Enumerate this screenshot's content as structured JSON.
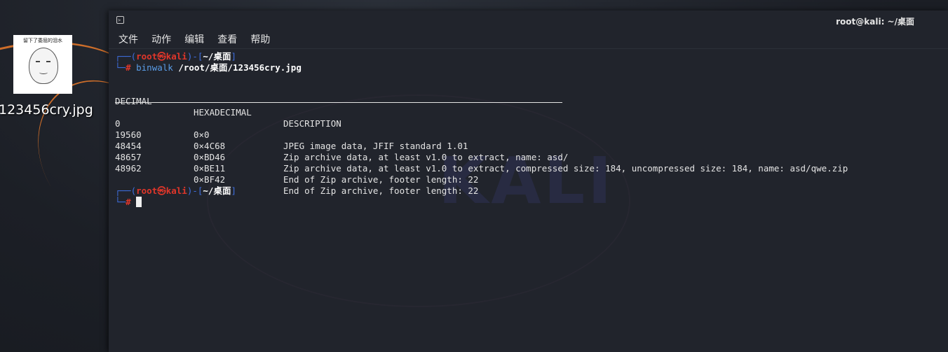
{
  "desktop": {
    "file_icon": {
      "thumb_caption": "留下了委屈的泪水",
      "label": "123456cry.jpg"
    }
  },
  "window": {
    "title": "root@kali: ~/桌面",
    "menu": [
      "文件",
      "动作",
      "编辑",
      "查看",
      "帮助"
    ]
  },
  "watermark": "KALI",
  "prompt": {
    "open": "┌──(",
    "user": "root㉿kali",
    "mid": ")-[",
    "path": "~/桌面",
    "close": "]",
    "second": "└─",
    "hash": "#"
  },
  "command": {
    "name": "binwalk",
    "arg": "/root/桌面/123456cry.jpg"
  },
  "table": {
    "headers": [
      "DECIMAL",
      "HEXADECIMAL",
      "DESCRIPTION"
    ],
    "rows": [
      [
        "0",
        "0×0",
        "JPEG image data, JFIF standard 1.01"
      ],
      [
        "19560",
        "0×4C68",
        "Zip archive data, at least v1.0 to extract, name: asd/"
      ],
      [
        "48454",
        "0×BD46",
        "Zip archive data, at least v1.0 to extract, compressed size: 184, uncompressed size: 184, name: asd/qwe.zip"
      ],
      [
        "48657",
        "0×BE11",
        "End of Zip archive, footer length: 22"
      ],
      [
        "48962",
        "0×BF42",
        "End of Zip archive, footer length: 22"
      ]
    ]
  }
}
